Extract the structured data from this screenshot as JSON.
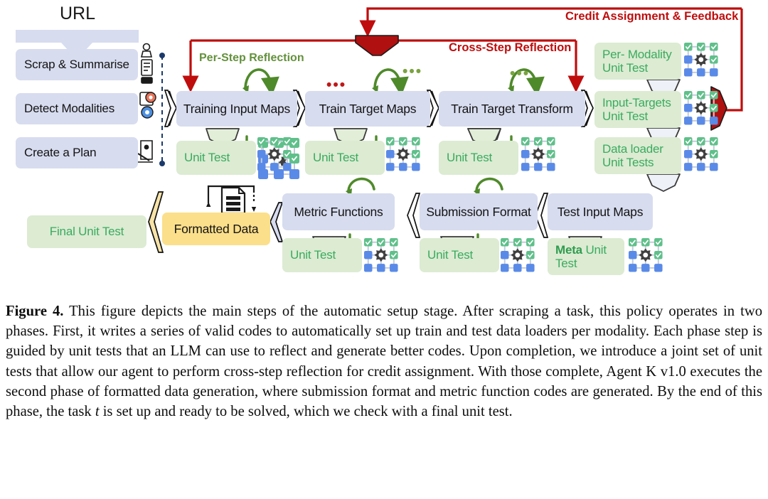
{
  "figure": {
    "url_label": "URL",
    "left_steps": [
      {
        "label": "Scrap & Summarise",
        "icon": "scrape-robot-icon"
      },
      {
        "label": "Detect Modalities",
        "icon": "modality-gear-eye-icon"
      },
      {
        "label": "Create a Plan",
        "icon": "plan-document-icon"
      }
    ],
    "annotations": {
      "per_step_reflection": "Per-Step Reflection",
      "cross_step_reflection": "Cross-Step Reflection",
      "credit_assignment": "Credit Assignment & Feedback",
      "ellipsis_red": "•••",
      "ellipsis_green": "•••"
    },
    "train_pipeline": [
      {
        "label": "Training Input Maps",
        "unit_test": "Unit Test"
      },
      {
        "label": "Train Target Maps",
        "unit_test": "Unit Test"
      },
      {
        "label": "Train Target Transform",
        "unit_test": "Unit Test"
      }
    ],
    "joint_tests": [
      "Per- Modality\nUnit Test",
      "Input-Targets\nUnit Test",
      "Data loader\nUnit Tests"
    ],
    "second_phase": [
      {
        "label": "Test Input Maps",
        "unit_test_prefix": "Meta",
        "unit_test": " Unit\nTest"
      },
      {
        "label": "Submission Format",
        "unit_test": "Unit Test"
      },
      {
        "label": "Metric Functions",
        "unit_test": "Unit Test"
      }
    ],
    "formatted_data": "Formatted Data",
    "final_unit_test": "Final Unit Test",
    "colors": {
      "blue_node": "#d7dcef",
      "green_node": "#dcebd2",
      "green_text": "#3aab5f",
      "yellow_node": "#fcdf8a",
      "red_accent": "#bf0d0d",
      "dark_red_fill": "#b01010",
      "green_arrow": "#4f8a2a",
      "grid_green": "#5fc08a",
      "grid_blue": "#5a8ae8",
      "gear_gray": "#3f3f3f"
    }
  },
  "caption": {
    "label": "Figure 4.",
    "text": " This figure depicts the main steps of the automatic setup stage. After scraping a task, this policy operates in two phases. First, it writes a series of valid codes to automatically set up train and test data loaders per modality. Each phase step is guided by unit tests that an LLM can use to reflect and generate better codes. Upon completion, we introduce a joint set of unit tests that allow our agent to perform cross-step reflection for credit assignment. With those complete, Agent K v1.0 executes the second phase of formatted data generation, where submission format and metric function codes are generated. By the end of this phase, the task ",
    "italic_var": "t",
    "text_tail": " is set up and ready to be solved, which we check with a final unit test."
  }
}
